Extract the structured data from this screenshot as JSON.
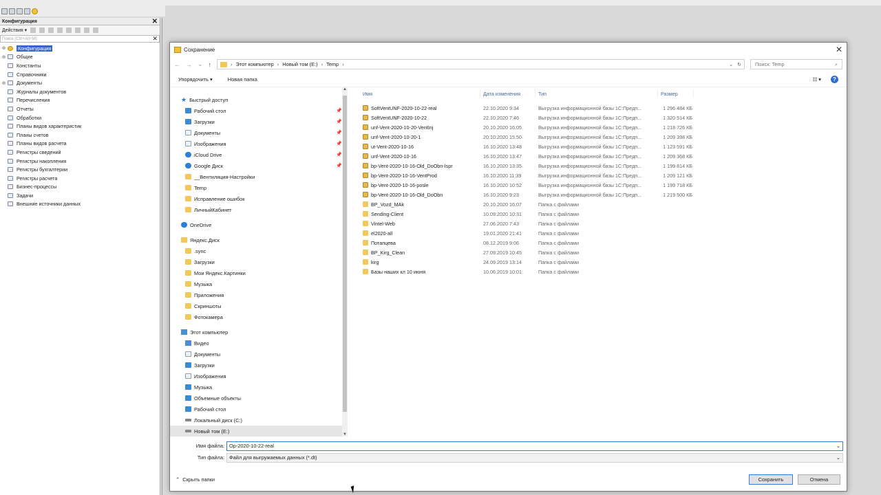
{
  "config_panel": {
    "title": "Конфигурация",
    "actions_label": "Действия ▾",
    "search_placeholder": "Поиск (Ctrl+Alt+M)",
    "tree": [
      {
        "label": "Конфигурация",
        "selected": true
      },
      {
        "label": "Общие"
      },
      {
        "label": "Константы"
      },
      {
        "label": "Справочники"
      },
      {
        "label": "Документы"
      },
      {
        "label": "Журналы документов"
      },
      {
        "label": "Перечисления"
      },
      {
        "label": "Отчеты"
      },
      {
        "label": "Обработки"
      },
      {
        "label": "Планы видов характеристик"
      },
      {
        "label": "Планы счетов"
      },
      {
        "label": "Планы видов расчета"
      },
      {
        "label": "Регистры сведений"
      },
      {
        "label": "Регистры накопления"
      },
      {
        "label": "Регистры бухгалтерии"
      },
      {
        "label": "Регистры расчета"
      },
      {
        "label": "Бизнес-процессы"
      },
      {
        "label": "Задачи"
      },
      {
        "label": "Внешние источники данных"
      }
    ]
  },
  "dialog": {
    "title": "Сохранение",
    "address": {
      "segments": [
        "Этот компьютер",
        "Новый том (E:)",
        "Temp"
      ]
    },
    "search_placeholder": "Поиск: Temp",
    "commands": {
      "organize": "Упорядочить ▾",
      "new_folder": "Новая папка"
    },
    "nav": [
      {
        "label": "Быстрый доступ",
        "icon": "star-icon",
        "top": true
      },
      {
        "label": "Рабочий стол",
        "icon": "desktop-icon",
        "pin": true
      },
      {
        "label": "Загрузки",
        "icon": "download-icon",
        "pin": true
      },
      {
        "label": "Документы",
        "icon": "document-icon",
        "pin": true
      },
      {
        "label": "Изображения",
        "icon": "image-icon",
        "pin": true
      },
      {
        "label": "iCloud Drive",
        "icon": "icloud-icon",
        "pin": true
      },
      {
        "label": "Google Диск",
        "icon": "google-drive-icon",
        "pin": true
      },
      {
        "label": "__Вентиляция-Настройки",
        "icon": "folder-icon"
      },
      {
        "label": "Temp",
        "icon": "folder-icon"
      },
      {
        "label": "Исправление ошибок",
        "icon": "folder-icon"
      },
      {
        "label": "ЛичныйКабинет",
        "icon": "folder-icon"
      },
      {
        "label": "OneDrive",
        "icon": "onedrive-icon",
        "top": true,
        "gap": true
      },
      {
        "label": "Яндекс.Диск",
        "icon": "yandex-disk-icon",
        "top": true,
        "gap": true
      },
      {
        "label": ".sync",
        "icon": "folder-icon"
      },
      {
        "label": "Загрузки",
        "icon": "folder-icon"
      },
      {
        "label": "Мои Яндекс.Картинки",
        "icon": "folder-icon"
      },
      {
        "label": "Музыка",
        "icon": "folder-icon"
      },
      {
        "label": "Приложения",
        "icon": "folder-icon"
      },
      {
        "label": "Скриншоты",
        "icon": "folder-icon"
      },
      {
        "label": "Фотокамера",
        "icon": "folder-icon"
      },
      {
        "label": "Этот компьютер",
        "icon": "computer-icon",
        "top": true,
        "gap": true
      },
      {
        "label": "Видео",
        "icon": "video-icon"
      },
      {
        "label": "Документы",
        "icon": "document-icon"
      },
      {
        "label": "Загрузки",
        "icon": "download-icon"
      },
      {
        "label": "Изображения",
        "icon": "image-icon"
      },
      {
        "label": "Музыка",
        "icon": "music-icon"
      },
      {
        "label": "Объемные объекты",
        "icon": "3d-objects-icon"
      },
      {
        "label": "Рабочий стол",
        "icon": "desktop-icon"
      },
      {
        "label": "Локальный диск (C:)",
        "icon": "drive-icon"
      },
      {
        "label": "Новый том (E:)",
        "icon": "drive-icon",
        "selected": true
      }
    ],
    "columns": {
      "name": "Имя",
      "date": "Дата изменения",
      "type": "Тип",
      "size": "Размер"
    },
    "files": [
      {
        "name": "SoftVentUNF-2020-10-22-real",
        "date": "22.10.2020 9:34",
        "type": "Выгрузка информационной базы 1С:Предп...",
        "size": "1 296 484 КБ",
        "kind": "archive"
      },
      {
        "name": "SoftVentUNF-2020-10-22",
        "date": "22.10.2020 7:46",
        "type": "Выгрузка информационной базы 1С:Предп...",
        "size": "1 320 514 КБ",
        "kind": "archive"
      },
      {
        "name": "unf-Vent-2020-10-20-VentInj",
        "date": "20.10.2020 16:05",
        "type": "Выгрузка информационной базы 1С:Предп...",
        "size": "1 218 726 КБ",
        "kind": "archive"
      },
      {
        "name": "unf-Vent-2020-10-20-1",
        "date": "20.10.2020 15:50",
        "type": "Выгрузка информационной базы 1С:Предп...",
        "size": "1 209 398 КБ",
        "kind": "archive"
      },
      {
        "name": "ut-Vent-2020-10-16",
        "date": "16.10.2020 13:48",
        "type": "Выгрузка информационной базы 1С:Предп...",
        "size": "1 123 591 КБ",
        "kind": "archive"
      },
      {
        "name": "unf-Vent-2020-10-16",
        "date": "16.10.2020 13:47",
        "type": "Выгрузка информационной базы 1С:Предп...",
        "size": "1 209 368 КБ",
        "kind": "archive"
      },
      {
        "name": "bp-Vent-2020-10-16-Old_DoObn-Ispr",
        "date": "16.10.2020 13:35",
        "type": "Выгрузка информационной базы 1С:Предп...",
        "size": "1 199 814 КБ",
        "kind": "archive"
      },
      {
        "name": "bp-Vent-2020-10-16-VentProd",
        "date": "16.10.2020 11:39",
        "type": "Выгрузка информационной базы 1С:Предп...",
        "size": "1 209 121 КБ",
        "kind": "archive"
      },
      {
        "name": "bp-Vent-2020-10-16-posle",
        "date": "16.10.2020 10:52",
        "type": "Выгрузка информационной базы 1С:Предп...",
        "size": "1 199 718 КБ",
        "kind": "archive"
      },
      {
        "name": "bp-Vent-2020-10-16-Old_DoObn",
        "date": "16.10.2020 9:23",
        "type": "Выгрузка информационной базы 1С:Предп...",
        "size": "1 219 500 КБ",
        "kind": "archive"
      },
      {
        "name": "BP_Vozd_MAk",
        "date": "20.10.2020 16:07",
        "type": "Папка с файлами",
        "size": "",
        "kind": "folder"
      },
      {
        "name": "Sending-Client",
        "date": "10.09.2020 10:31",
        "type": "Папка с файлами",
        "size": "",
        "kind": "folder"
      },
      {
        "name": "Vintel-Web",
        "date": "27.06.2020 7:43",
        "type": "Папка с файлами",
        "size": "",
        "kind": "folder"
      },
      {
        "name": "el2020-all",
        "date": "19.01.2020 21:41",
        "type": "Папка с файлами",
        "size": "",
        "kind": "folder"
      },
      {
        "name": "Потапцева",
        "date": "08.12.2019 9:06",
        "type": "Папка с файлами",
        "size": "",
        "kind": "folder"
      },
      {
        "name": "BP_Kirg_Clean",
        "date": "27.09.2019 10:45",
        "type": "Папка с файлами",
        "size": "",
        "kind": "folder"
      },
      {
        "name": "kirg",
        "date": "24.09.2019 13:14",
        "type": "Папка с файлами",
        "size": "",
        "kind": "folder"
      },
      {
        "name": "Базы наших кл 10 июня",
        "date": "10.06.2019 10:01",
        "type": "Папка с файлами",
        "size": "",
        "kind": "folder"
      }
    ],
    "filename_label": "Имя файла:",
    "filename_value": "Op-2020-10-22-real",
    "filetype_label": "Тип файла:",
    "filetype_value": "Файл для выгружаемых данных (*.dt)",
    "hide_folders": "Скрыть папки",
    "save_label": "Сохранить",
    "cancel_label": "Отмена"
  }
}
